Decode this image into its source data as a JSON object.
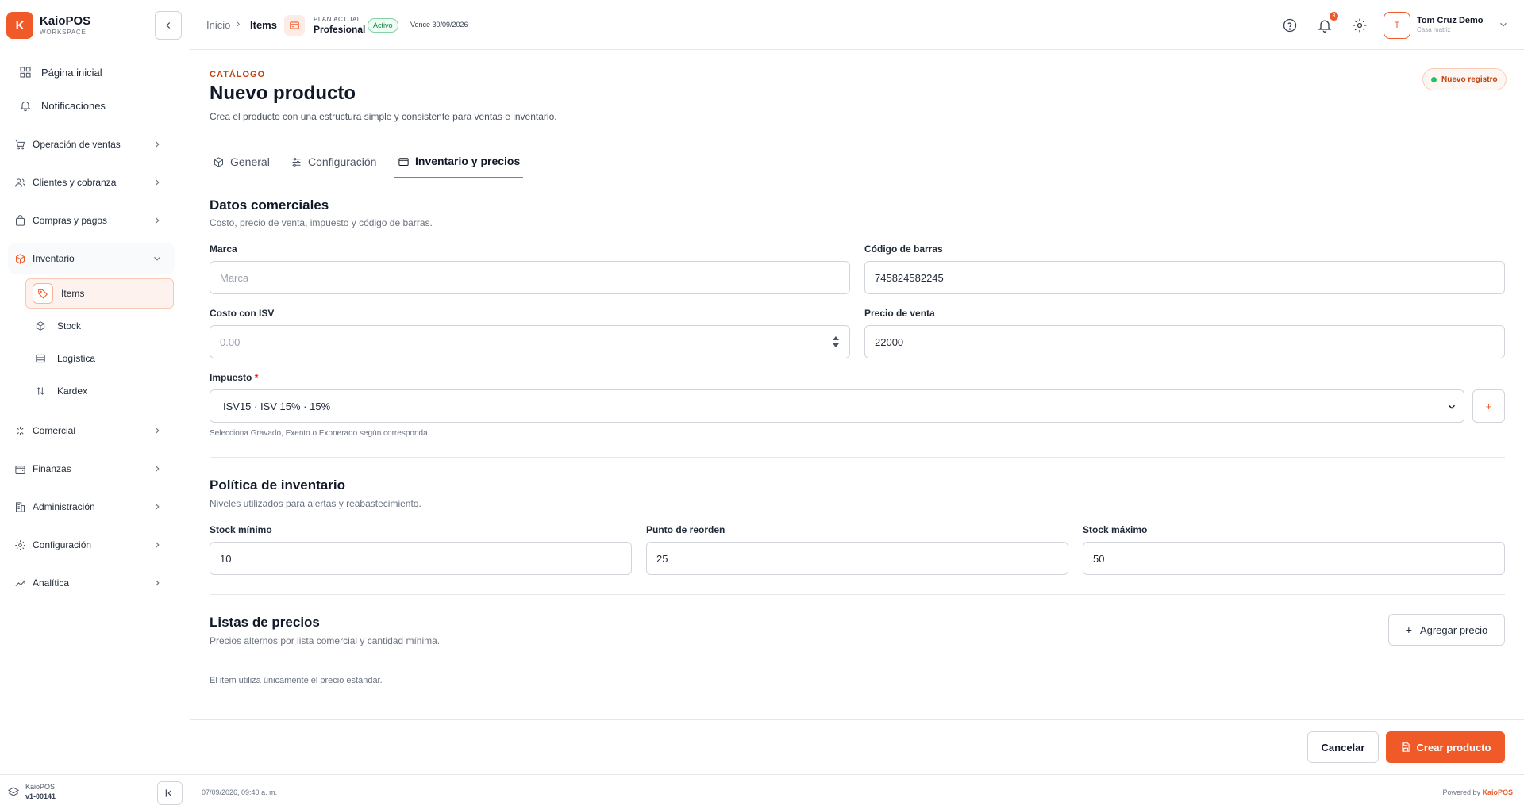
{
  "brand": {
    "logo_letter": "K",
    "name": "KaioPOS",
    "sub": "WORKSPACE"
  },
  "sidebar": {
    "top_items": [
      {
        "label": "Página inicial",
        "icon": "grid-icon"
      },
      {
        "label": "Notificaciones",
        "icon": "bell-icon"
      }
    ],
    "groups": [
      {
        "label": "Operación de ventas",
        "icon": "cart-icon"
      },
      {
        "label": "Clientes y cobranza",
        "icon": "users-icon"
      },
      {
        "label": "Compras y pagos",
        "icon": "bag-icon"
      },
      {
        "label": "Inventario",
        "icon": "box-icon",
        "expanded": true
      },
      {
        "label": "Comercial",
        "icon": "sparkle-icon"
      },
      {
        "label": "Finanzas",
        "icon": "wallet-icon"
      },
      {
        "label": "Administración",
        "icon": "building-icon"
      },
      {
        "label": "Configuración",
        "icon": "gear-icon"
      },
      {
        "label": "Analítica",
        "icon": "trend-icon"
      }
    ],
    "inventory_sub": [
      {
        "label": "Items",
        "icon": "tag-icon",
        "active": true
      },
      {
        "label": "Stock",
        "icon": "cube-icon"
      },
      {
        "label": "Logística",
        "icon": "warehouse-icon"
      },
      {
        "label": "Kardex",
        "icon": "swap-icon"
      }
    ],
    "footer": {
      "name": "KaioPOS",
      "version": "v1-00141"
    }
  },
  "header": {
    "breadcrumb": {
      "home": "Inicio",
      "sep": "›",
      "current": "Items"
    },
    "plan": {
      "label": "PLAN ACTUAL",
      "name": "Profesional",
      "status": "Activo",
      "expires": "Vence 30/09/2026"
    },
    "notifications_count": "3",
    "user": {
      "initial": "T",
      "name": "Tom Cruz Demo",
      "sub": "Casa matriz"
    }
  },
  "page": {
    "eyebrow": "CATÁLOGO",
    "title": "Nuevo producto",
    "description": "Crea el producto con una estructura simple y consistente para ventas e inventario.",
    "status": "Nuevo registro"
  },
  "tabs": [
    {
      "label": "General",
      "active": false
    },
    {
      "label": "Configuración",
      "active": false
    },
    {
      "label": "Inventario y precios",
      "active": true
    }
  ],
  "commercial": {
    "title": "Datos comerciales",
    "description": "Costo, precio de venta, impuesto y código de barras.",
    "brand_label": "Marca",
    "brand_placeholder": "Marca",
    "brand_value": "",
    "barcode_label": "Código de barras",
    "barcode_value": "745824582245",
    "cost_label": "Costo con ISV",
    "cost_placeholder": "0.00",
    "price_label": "Precio de venta",
    "price_value": "22000",
    "tax_label": "Impuesto",
    "tax_required": "*",
    "tax_value": "ISV15 · ISV 15% · 15%",
    "tax_add": "+",
    "tax_hint": "Selecciona Gravado, Exento o Exonerado según corresponda."
  },
  "inventory_policy": {
    "title": "Política de inventario",
    "description": "Niveles utilizados para alertas y reabastecimiento.",
    "min_label": "Stock mínimo",
    "min_value": "10",
    "reorder_label": "Punto de reorden",
    "reorder_value": "25",
    "max_label": "Stock máximo",
    "max_value": "50"
  },
  "price_lists": {
    "title": "Listas de precios",
    "description": "Precios alternos por lista comercial y cantidad mínima.",
    "add_label": "Agregar precio",
    "empty": "El item utiliza únicamente el precio estándar."
  },
  "actions": {
    "cancel": "Cancelar",
    "create": "Crear producto"
  },
  "footer": {
    "timestamp": "07/09/2026, 09:40 a. m.",
    "powered_prefix": "Powered by",
    "powered_brand": "KaioPOS"
  },
  "colors": {
    "accent": "#f05a28",
    "success": "#22c55e"
  }
}
